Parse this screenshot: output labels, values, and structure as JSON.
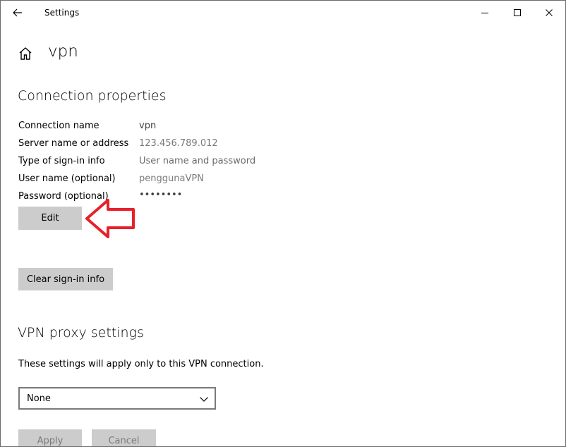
{
  "window": {
    "title": "Settings",
    "back_icon": "arrow-left-icon",
    "controls": [
      "minimize-icon",
      "maximize-icon",
      "close-icon"
    ]
  },
  "header": {
    "home_icon": "home-icon",
    "page_title": "vpn"
  },
  "connection": {
    "heading": "Connection properties",
    "properties": [
      {
        "label": "Connection name",
        "value": "vpn"
      },
      {
        "label": "Server name or address",
        "value": "123.456.789.012"
      },
      {
        "label": "Type of sign-in info",
        "value": "User name and password"
      },
      {
        "label": "User name (optional)",
        "value": "penggunaVPN"
      },
      {
        "label": "Password (optional)",
        "value": "••••••••"
      }
    ],
    "edit_label": "Edit",
    "clear_label": "Clear sign-in info"
  },
  "proxy": {
    "heading": "VPN proxy settings",
    "description": "These settings will apply only to this VPN connection.",
    "selected": "None",
    "apply_label": "Apply",
    "cancel_label": "Cancel"
  },
  "annotation": {
    "arrow_color": "#e8202a"
  }
}
